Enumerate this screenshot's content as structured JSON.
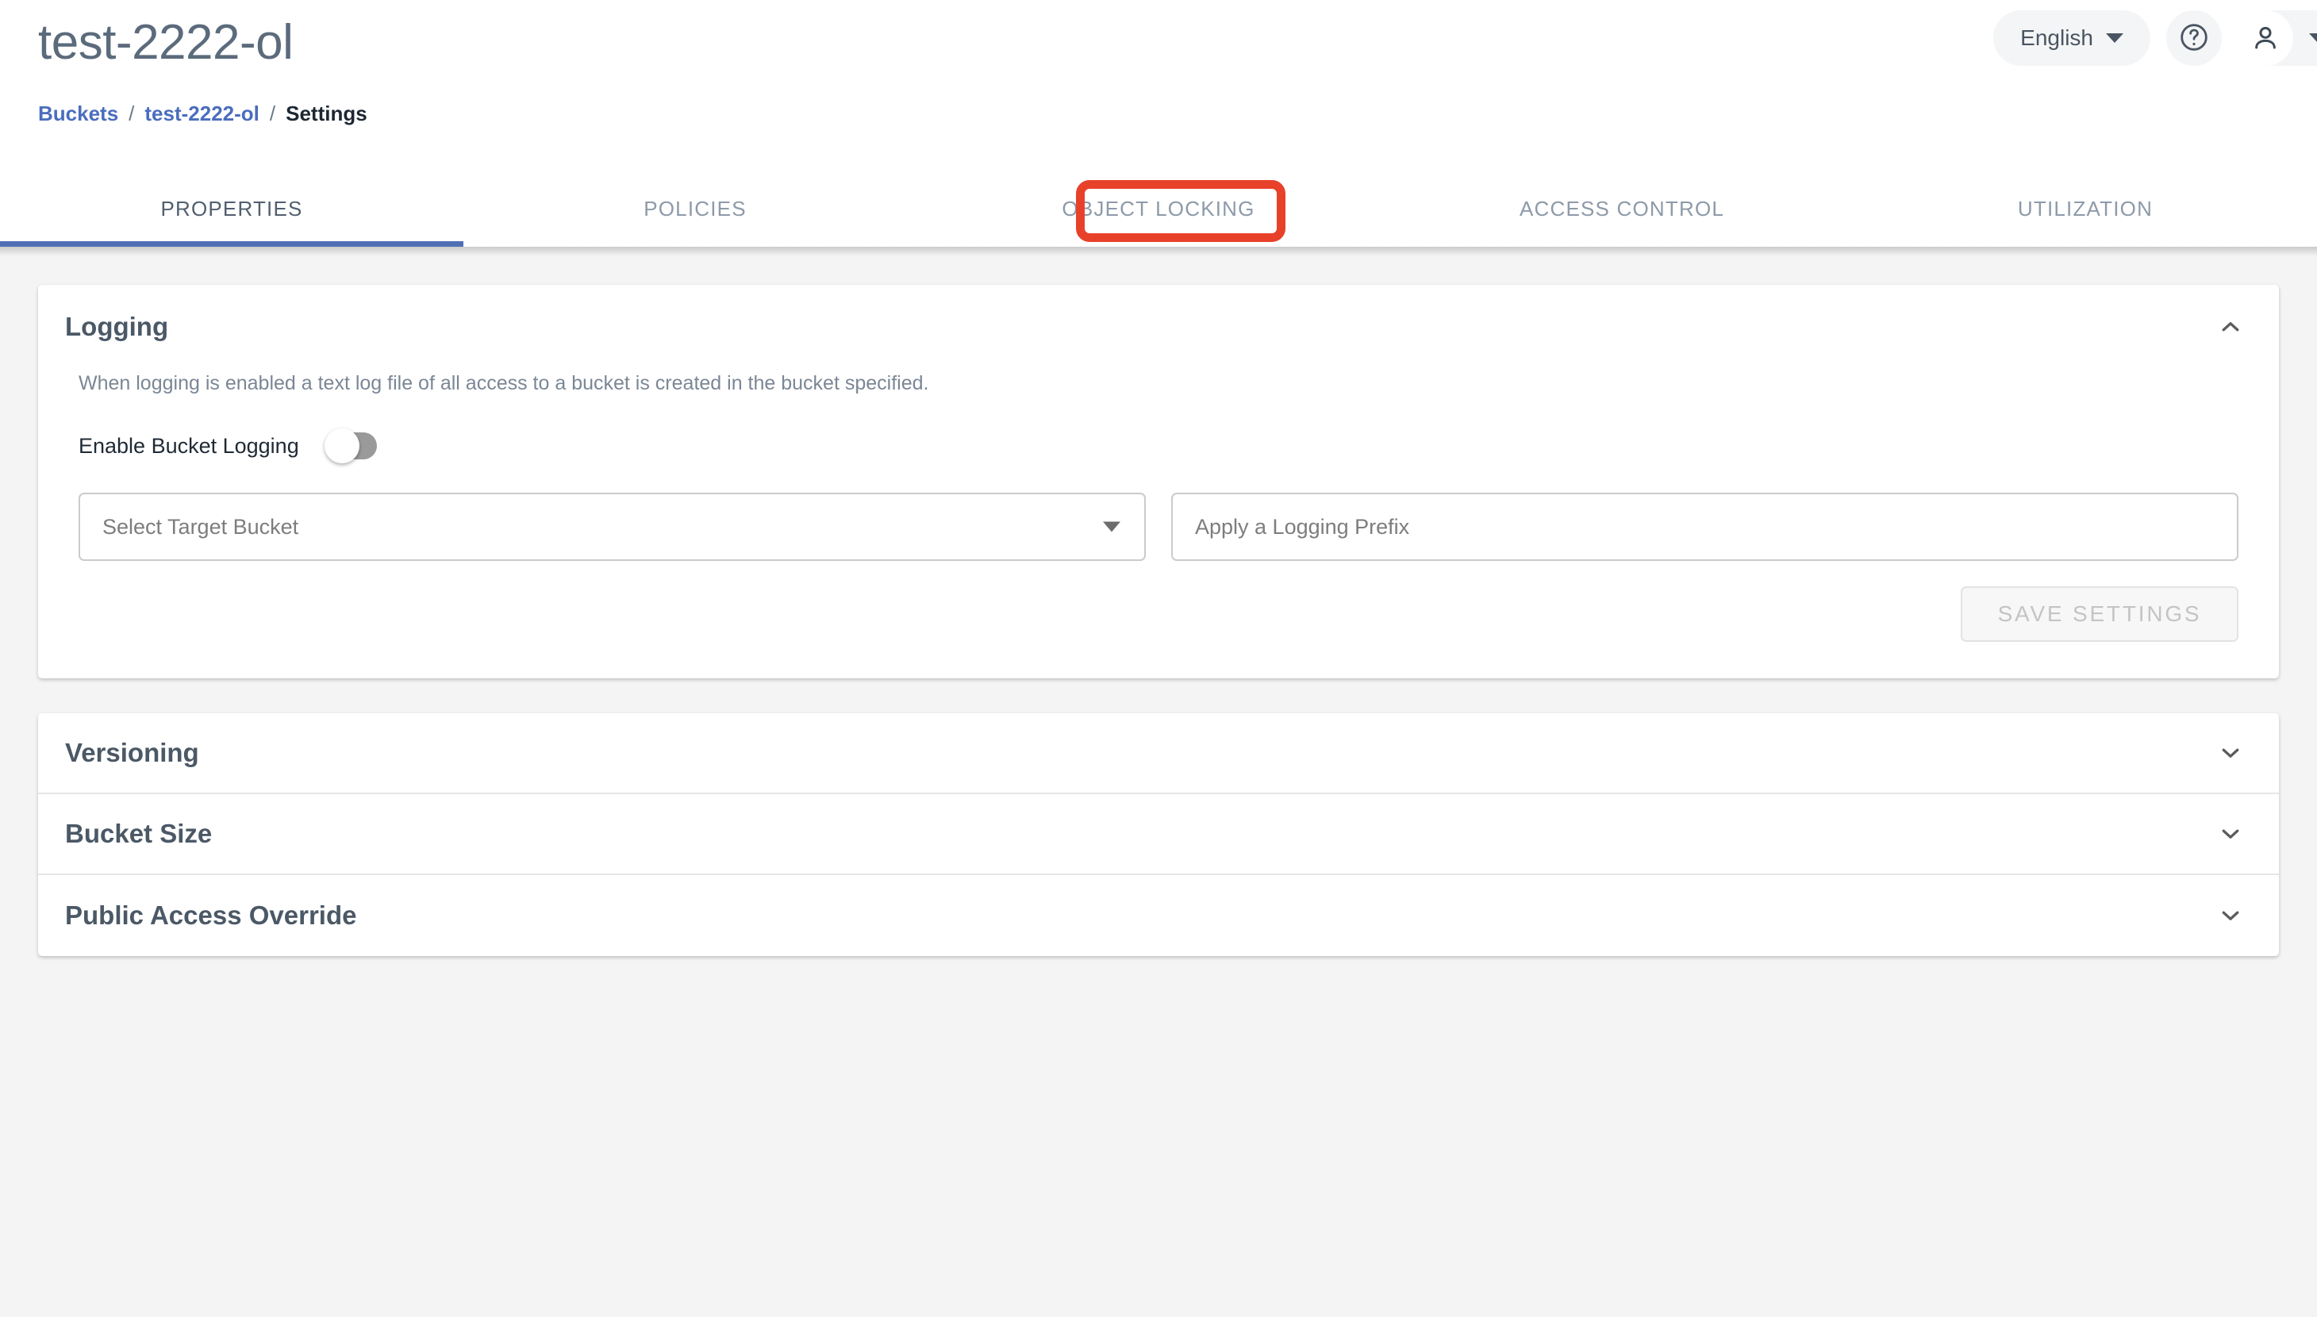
{
  "header": {
    "page_title": "test-2222-ol",
    "breadcrumb": {
      "root": "Buckets",
      "separator1": "/",
      "bucket": "test-2222-ol",
      "separator2": "/",
      "current": "Settings"
    },
    "language_label": "English",
    "help_icon": "help-circle-icon",
    "account_icon": "user-icon"
  },
  "tabs": [
    {
      "label": "PROPERTIES",
      "active": true
    },
    {
      "label": "POLICIES",
      "active": false
    },
    {
      "label": "OBJECT LOCKING",
      "active": false,
      "highlighted": true
    },
    {
      "label": "ACCESS CONTROL",
      "active": false
    },
    {
      "label": "UTILIZATION",
      "active": false
    }
  ],
  "logging": {
    "title": "Logging",
    "description": "When logging is enabled a text log file of all access to a bucket is created in the bucket specified.",
    "toggle_label": "Enable Bucket Logging",
    "toggle_state": "off",
    "target_bucket_placeholder": "Select Target Bucket",
    "target_bucket_value": "",
    "logging_prefix_placeholder": "Apply a Logging Prefix",
    "logging_prefix_value": "",
    "save_label": "SAVE SETTINGS",
    "save_disabled": true,
    "collapse_icon": "chevron-up-icon"
  },
  "sections": [
    {
      "title": "Versioning",
      "expanded": false,
      "icon": "chevron-down-icon"
    },
    {
      "title": "Bucket Size",
      "expanded": false,
      "icon": "chevron-down-icon"
    },
    {
      "title": "Public Access Override",
      "expanded": false,
      "icon": "chevron-down-icon"
    }
  ],
  "colors": {
    "accent_blue": "#4f6fb5",
    "link_blue": "#4a6dbd",
    "annotation_red": "#e8412a",
    "page_background": "#f4f4f4",
    "title_gray": "#5b6b7c"
  }
}
